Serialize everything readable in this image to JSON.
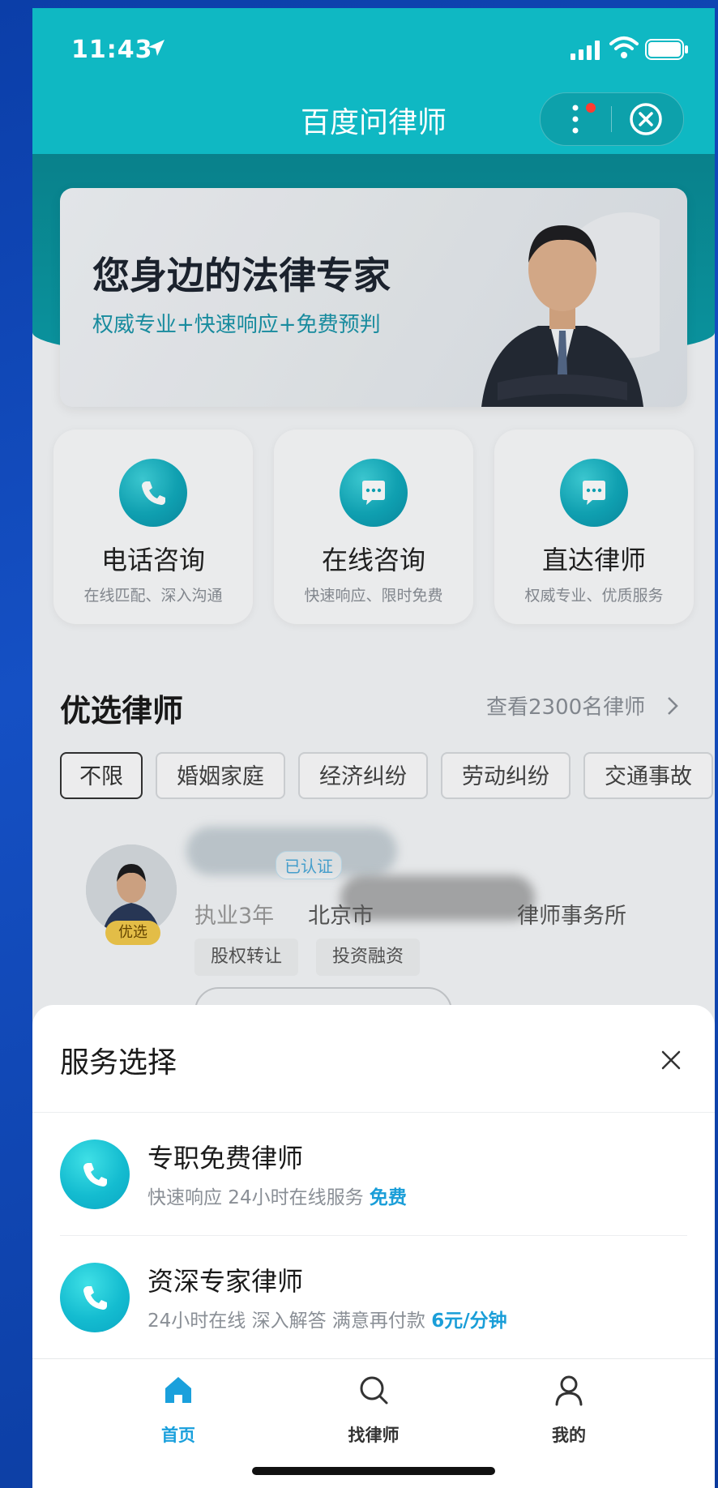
{
  "status_bar": {
    "time": "11:43"
  },
  "nav": {
    "title": "百度问律师"
  },
  "banner": {
    "title": "您身边的法律专家",
    "subtitle": "权威专业+快速响应+免费预判"
  },
  "services": [
    {
      "title": "电话咨询",
      "desc": "在线匹配、深入沟通",
      "icon": "phone-icon"
    },
    {
      "title": "在线咨询",
      "desc": "快速响应、限时免费",
      "icon": "chat-icon"
    },
    {
      "title": "直达律师",
      "desc": "权威专业、优质服务",
      "icon": "chat-icon"
    }
  ],
  "featured": {
    "title": "优选律师",
    "view_all": "查看2300名律师",
    "chips": [
      "不限",
      "婚姻家庭",
      "经济纠纷",
      "劳动纠纷",
      "交通事故"
    ],
    "lawyer": {
      "badge": "优选",
      "verified": "已认证",
      "years": "执业3年",
      "firm_prefix": "北京市",
      "firm_suffix": "律师事务所",
      "tags": [
        "股权转让",
        "投资融资"
      ]
    }
  },
  "sheet": {
    "title": "服务选择",
    "options": [
      {
        "title": "专职免费律师",
        "desc": "快速响应 24小时在线服务",
        "price": "免费"
      },
      {
        "title": "资深专家律师",
        "desc": "24小时在线 深入解答 满意再付款",
        "price": "6元/分钟"
      }
    ]
  },
  "tabs": [
    {
      "label": "首页",
      "icon": "home-icon",
      "active": true
    },
    {
      "label": "找律师",
      "icon": "search-icon",
      "active": false
    },
    {
      "label": "我的",
      "icon": "user-icon",
      "active": false
    }
  ],
  "colors": {
    "brand_teal": "#0fb8c3",
    "accent_blue": "#1aa0dc",
    "price_blue": "#1a9ed8"
  }
}
